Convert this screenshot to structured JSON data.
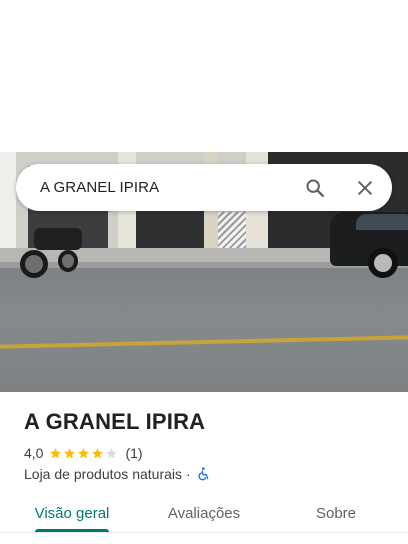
{
  "search": {
    "query": "A GRANEL IPIRA",
    "search_icon": "search-icon",
    "close_icon": "close-icon"
  },
  "place": {
    "name": "A GRANEL IPIRA",
    "rating": "4,0",
    "rating_value": 4,
    "rating_max": 5,
    "review_count": "(1)",
    "category": "Loja de produtos naturais",
    "separator": "·",
    "accessibility_icon": "wheelchair-accessible-icon"
  },
  "tabs": [
    {
      "label": "Visão geral",
      "active": true
    },
    {
      "label": "Avaliações",
      "active": false
    },
    {
      "label": "Sobre",
      "active": false
    }
  ],
  "colors": {
    "accent": "#01796f",
    "star_filled": "#fbbc04",
    "star_empty": "#dadce0",
    "accessibility": "#1a73e8"
  }
}
